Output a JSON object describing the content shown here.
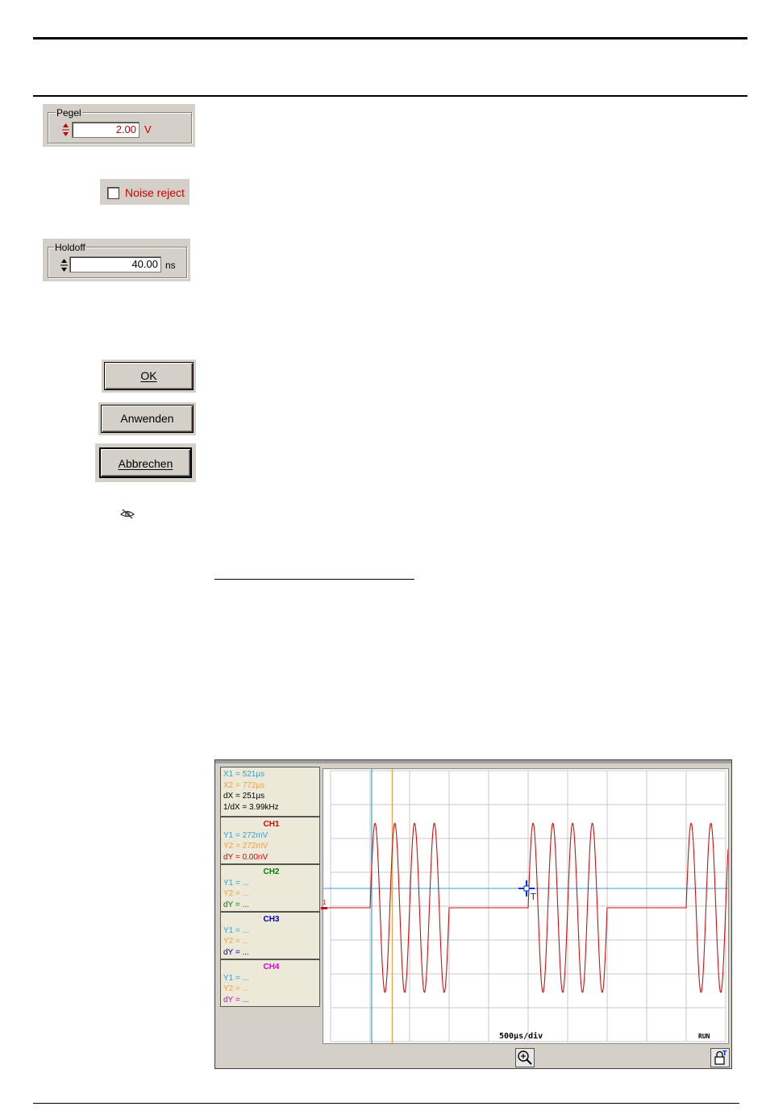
{
  "pegel": {
    "label": "Pegel",
    "value": "2.00",
    "unit": "V"
  },
  "noise_reject": {
    "label": "Noise reject",
    "checked": false
  },
  "holdoff": {
    "label": "Holdoff",
    "value": "40.00",
    "unit": "ns"
  },
  "buttons": {
    "ok": "OK",
    "apply": "Anwenden",
    "cancel": "Abbrechen"
  },
  "scope": {
    "measurements": {
      "x1": "X1 = 521µs",
      "x2": "X2 = 772µs",
      "dx": "dX = 251µs",
      "inv_dx": "1/dX = 3.99kHz"
    },
    "channels": [
      {
        "name": "CH1",
        "y1": "Y1 = 272mV",
        "y2": "Y2 = 272mV",
        "dy": "dY = 0.00nV",
        "color": "#e00000"
      },
      {
        "name": "CH2",
        "y1": "Y1 = ...",
        "y2": "Y2 = ...",
        "dy": "dY = ...",
        "color": "#008000"
      },
      {
        "name": "CH3",
        "y1": "Y1 = ...",
        "y2": "Y2 = ...",
        "dy": "dY = ...",
        "color": "#0000c0"
      },
      {
        "name": "CH4",
        "y1": "Y1 = ...",
        "y2": "Y2 = ...",
        "dy": "dY = ...",
        "color": "#e000e0"
      }
    ],
    "timebase": "500µs/div",
    "status": "RUN",
    "channel_marker": "1",
    "colors": {
      "cursor1": "#3aa0d0",
      "cursor2": "#f0a040",
      "trace": "#d01010",
      "grid": "#c8c8c8"
    }
  },
  "chart_data": {
    "type": "line",
    "x": "time (div)",
    "divisions_x": 10,
    "divisions_y": 8,
    "series": [
      {
        "name": "CH1",
        "description": "periodic bursts of 4 sine cycles, amplitude ~4.5 div, on a flat baseline",
        "burst_start_div": [
          1.0,
          5.0,
          9.0
        ],
        "cycles_per_burst": 4,
        "cycle_period_div": 0.5
      }
    ],
    "cursor_x1_div": 1.04,
    "cursor_x2_div": 1.56
  }
}
